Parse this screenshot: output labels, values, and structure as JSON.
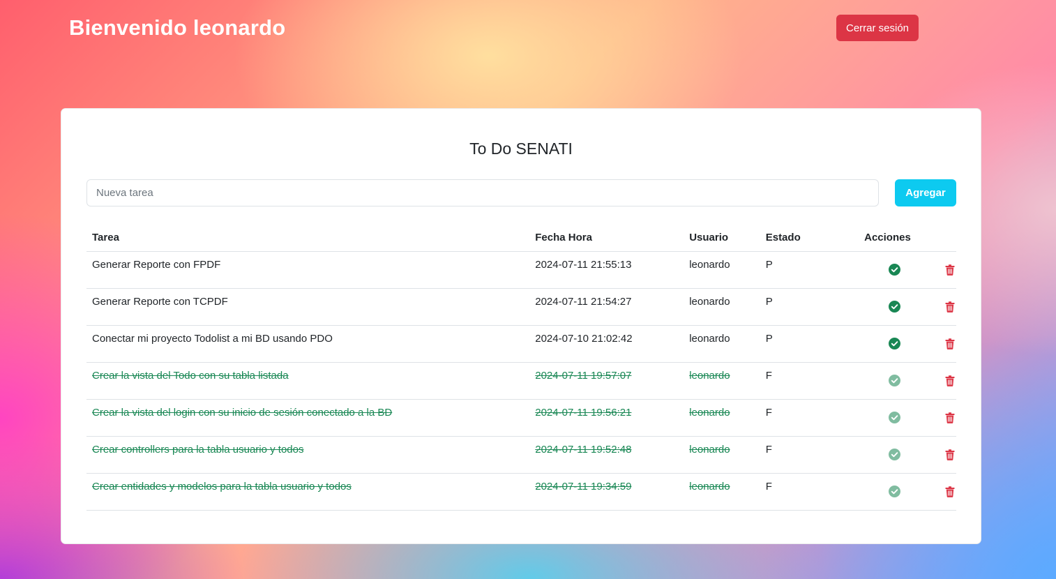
{
  "header": {
    "welcome_text": "Bienvenido leonardo",
    "logout_label": "Cerrar sesión"
  },
  "card": {
    "title": "To Do SENATI",
    "input_placeholder": "Nueva tarea",
    "add_label": "Agregar"
  },
  "table": {
    "columns": [
      "Tarea",
      "Fecha Hora",
      "Usuario",
      "Estado",
      "Acciones"
    ],
    "rows": [
      {
        "tarea": "Generar Reporte con FPDF",
        "fecha": "2024-07-11 21:55:13",
        "usuario": "leonardo",
        "estado": "P"
      },
      {
        "tarea": "Generar Reporte con TCPDF",
        "fecha": "2024-07-11 21:54:27",
        "usuario": "leonardo",
        "estado": "P"
      },
      {
        "tarea": "Conectar mi proyecto Todolist a mi BD usando PDO",
        "fecha": "2024-07-10 21:02:42",
        "usuario": "leonardo",
        "estado": "P"
      },
      {
        "tarea": "Crear la vista del Todo con su tabla listada",
        "fecha": "2024-07-11 19:57:07",
        "usuario": "leonardo",
        "estado": "F"
      },
      {
        "tarea": "Crear la vista del login con su inicio de sesión conectado a la BD",
        "fecha": "2024-07-11 19:56:21",
        "usuario": "leonardo",
        "estado": "F"
      },
      {
        "tarea": "Crear controllers para la tabla usuario y todos",
        "fecha": "2024-07-11 19:52:48",
        "usuario": "leonardo",
        "estado": "F"
      },
      {
        "tarea": "Crear entidades y modelos para la tabla usuario y todos",
        "fecha": "2024-07-11 19:34:59",
        "usuario": "leonardo",
        "estado": "F"
      }
    ],
    "icons": {
      "complete": "check-circle-icon",
      "delete": "trash-icon"
    }
  },
  "colors": {
    "danger": "#dc3545",
    "info": "#0dcaf0",
    "success": "#198754"
  }
}
